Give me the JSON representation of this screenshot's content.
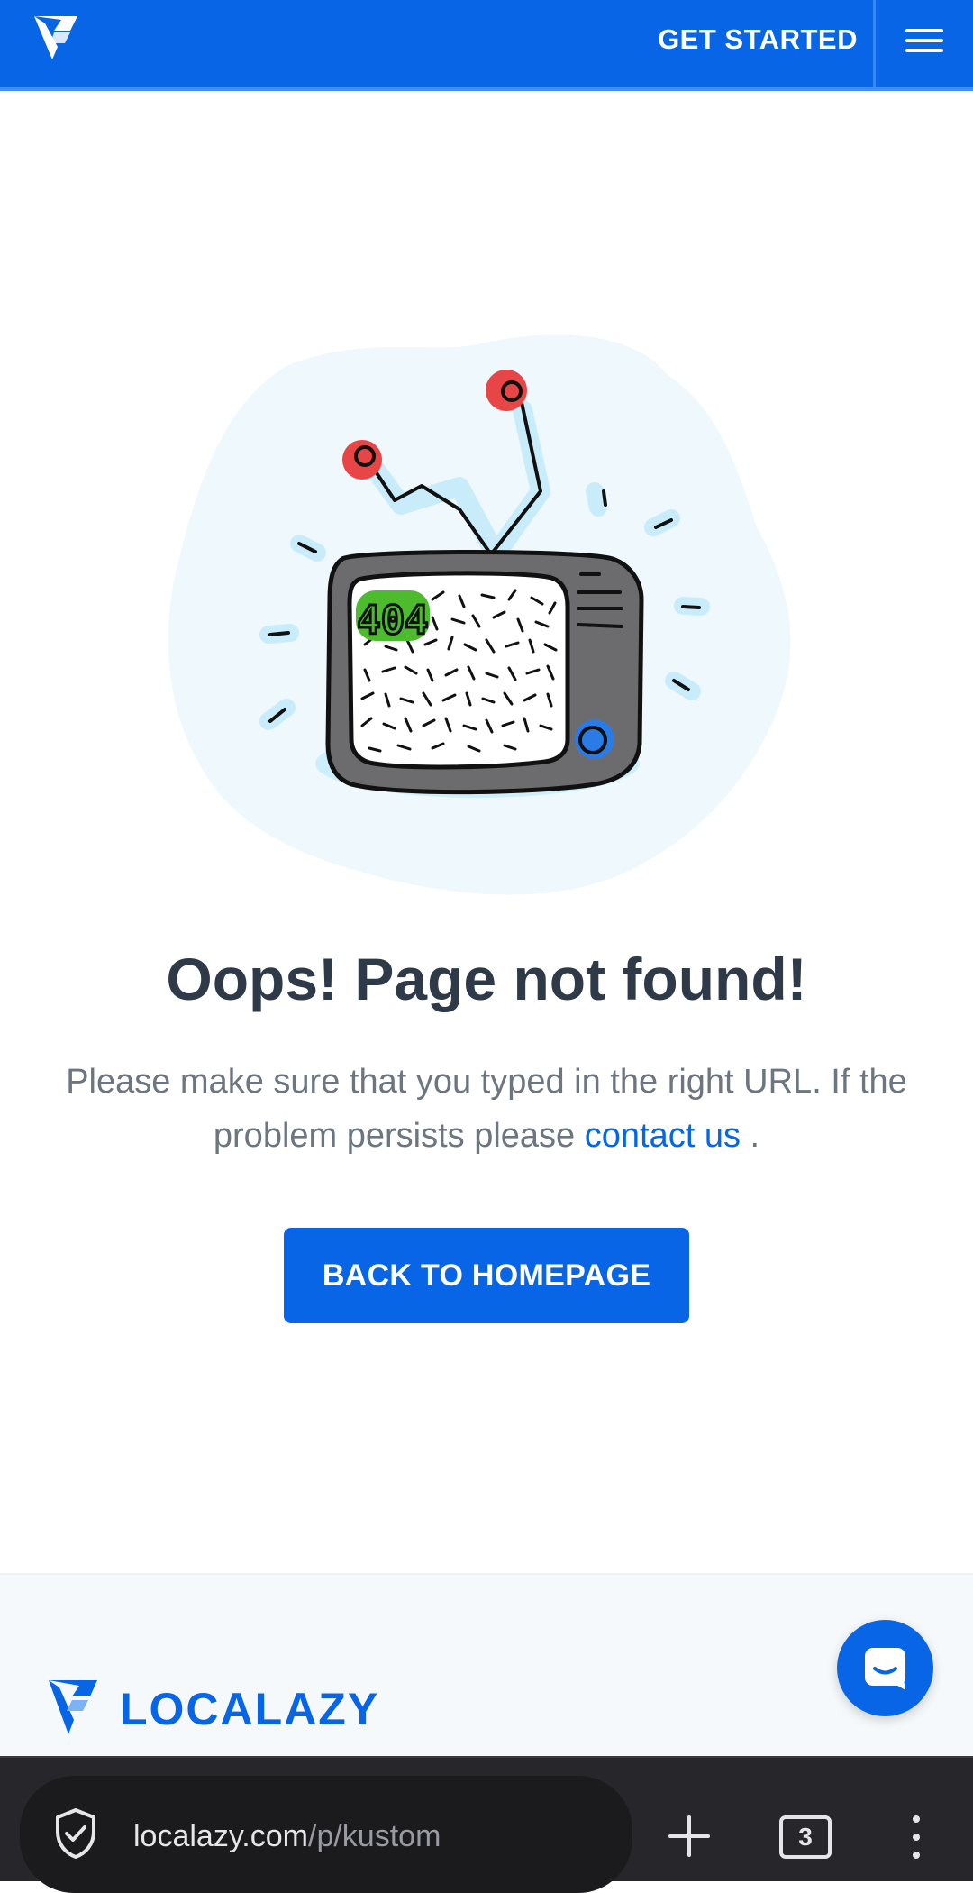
{
  "header": {
    "logo_icon": "localazy-logo-icon",
    "get_started_label": "GET STARTED",
    "menu_icon": "hamburger-menu-icon",
    "background_color": "#0866e6"
  },
  "illustration": {
    "icon": "broken-tv-icon",
    "screen_text": "404"
  },
  "main": {
    "title": "Oops! Page not found!",
    "message_part1": "Please make sure that you typed in the right URL. If the problem persists please",
    "contact_link": "contact us",
    "message_part2": ".",
    "cta_label": "BACK TO HOMEPAGE"
  },
  "footer": {
    "brand_name": "LOCALAZY",
    "chat_icon": "chat-bubble-icon"
  },
  "browser": {
    "url_domain": "localazy.com",
    "url_path": "/p/kustom",
    "tab_count": "3",
    "security_icon": "shield-check-icon",
    "new_tab_icon": "plus-icon",
    "more_icon": "vertical-dots-icon"
  },
  "colors": {
    "accent": "#0866e6",
    "title_text": "#2e3a48",
    "body_text": "#6d7680",
    "tv_antenna_tips": "#e84646",
    "tv_404_text": "#4dbb2e"
  }
}
